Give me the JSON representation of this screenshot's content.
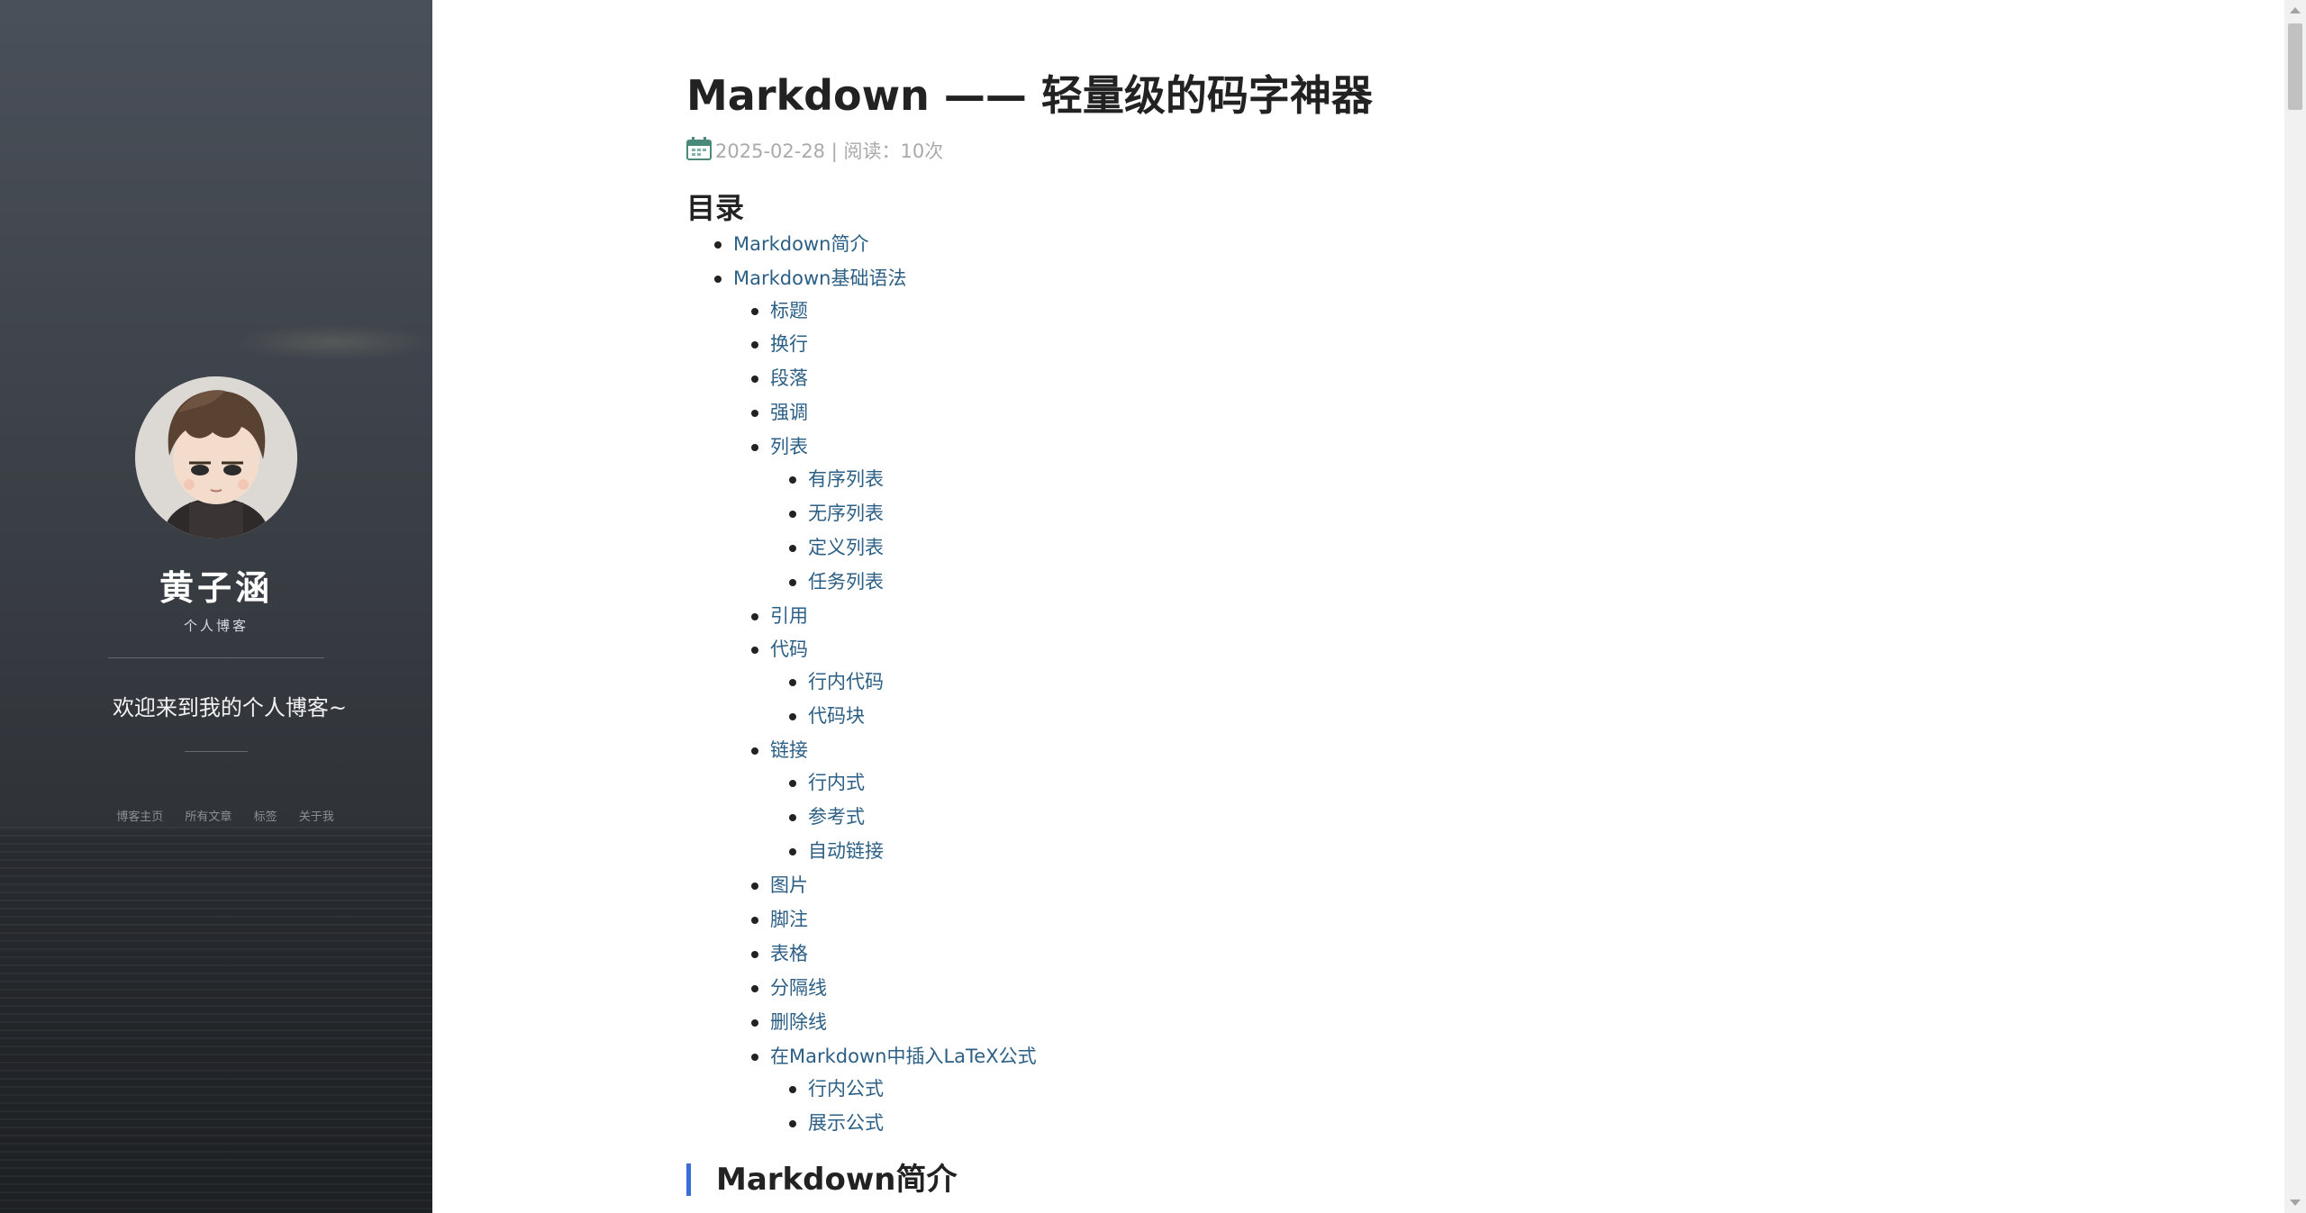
{
  "sidebar": {
    "author_name": "黄子涵",
    "author_subtitle": "个人博客",
    "welcome": "欢迎来到我的个人博客~",
    "nav": [
      "博客主页",
      "所有文章",
      "标签",
      "关于我"
    ]
  },
  "post": {
    "title": "Markdown —— 轻量级的码字神器",
    "date": "2025-02-28",
    "meta_separator": " | ",
    "reads": "阅读：10次"
  },
  "toc": {
    "title": "目录",
    "items": [
      {
        "label": "Markdown简介",
        "level": 1
      },
      {
        "label": "Markdown基础语法",
        "level": 1
      },
      {
        "label": "标题",
        "level": 2
      },
      {
        "label": "换行",
        "level": 2
      },
      {
        "label": "段落",
        "level": 2
      },
      {
        "label": "强调",
        "level": 2
      },
      {
        "label": "列表",
        "level": 2
      },
      {
        "label": "有序列表",
        "level": 3
      },
      {
        "label": "无序列表",
        "level": 3
      },
      {
        "label": "定义列表",
        "level": 3
      },
      {
        "label": "任务列表",
        "level": 3
      },
      {
        "label": "引用",
        "level": 2
      },
      {
        "label": "代码",
        "level": 2
      },
      {
        "label": "行内代码",
        "level": 3
      },
      {
        "label": "代码块",
        "level": 3
      },
      {
        "label": "链接",
        "level": 2
      },
      {
        "label": "行内式",
        "level": 3
      },
      {
        "label": "参考式",
        "level": 3
      },
      {
        "label": "自动链接",
        "level": 3
      },
      {
        "label": "图片",
        "level": 2
      },
      {
        "label": "脚注",
        "level": 2
      },
      {
        "label": "表格",
        "level": 2
      },
      {
        "label": "分隔线",
        "level": 2
      },
      {
        "label": "删除线",
        "level": 2
      },
      {
        "label": "在Markdown中插入LaTeX公式",
        "level": 2
      },
      {
        "label": "行内公式",
        "level": 3
      },
      {
        "label": "展示公式",
        "level": 3
      }
    ]
  },
  "section": {
    "heading": "Markdown简介"
  },
  "colors": {
    "link": "#2c5f85",
    "accent": "#3b6fd6",
    "text": "#222222",
    "meta": "#aaaaaa"
  }
}
